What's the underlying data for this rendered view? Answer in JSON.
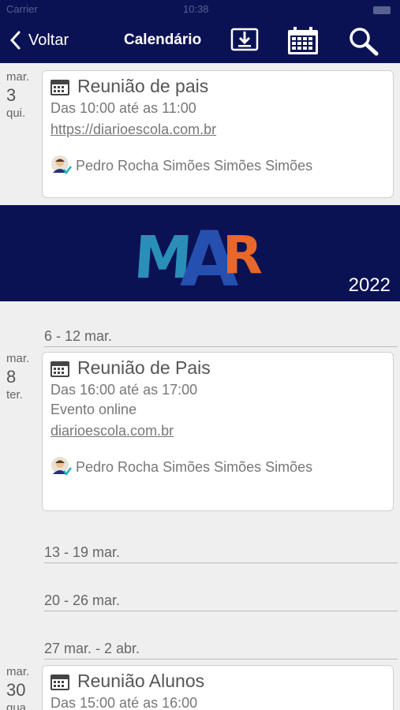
{
  "status": {
    "carrier": "Carrier",
    "time": "10:38"
  },
  "header": {
    "back_label": "Voltar",
    "title": "Calendário"
  },
  "banner": {
    "month": "MAR",
    "year": "2022"
  },
  "events": [
    {
      "month": "mar.",
      "day": "3",
      "weekday": "qui.",
      "title": "Reunião de pais",
      "time": "Das 10:00 até as 11:00",
      "link": "https://diarioescola.com.br",
      "author": "Pedro Rocha Simões Simões Simões"
    },
    {
      "month": "mar.",
      "day": "8",
      "weekday": "ter.",
      "title": "Reunião de Pais",
      "time": "Das 16:00 até as 17:00",
      "location": "Evento online",
      "link": "diarioescola.com.br",
      "author": "Pedro Rocha Simões Simões Simões"
    },
    {
      "month": "mar.",
      "day": "30",
      "weekday": "qua.",
      "title": "Reunião Alunos",
      "time": "Das 15:00 até as 16:00"
    }
  ],
  "weeks": [
    "6 - 12 mar.",
    "13 - 19 mar.",
    "20 - 26 mar.",
    "27 mar. - 2 abr."
  ],
  "colors": {
    "header_bg": "#0b1254",
    "logo_blue": "#2a8fb8",
    "logo_orange": "#e8672a"
  }
}
